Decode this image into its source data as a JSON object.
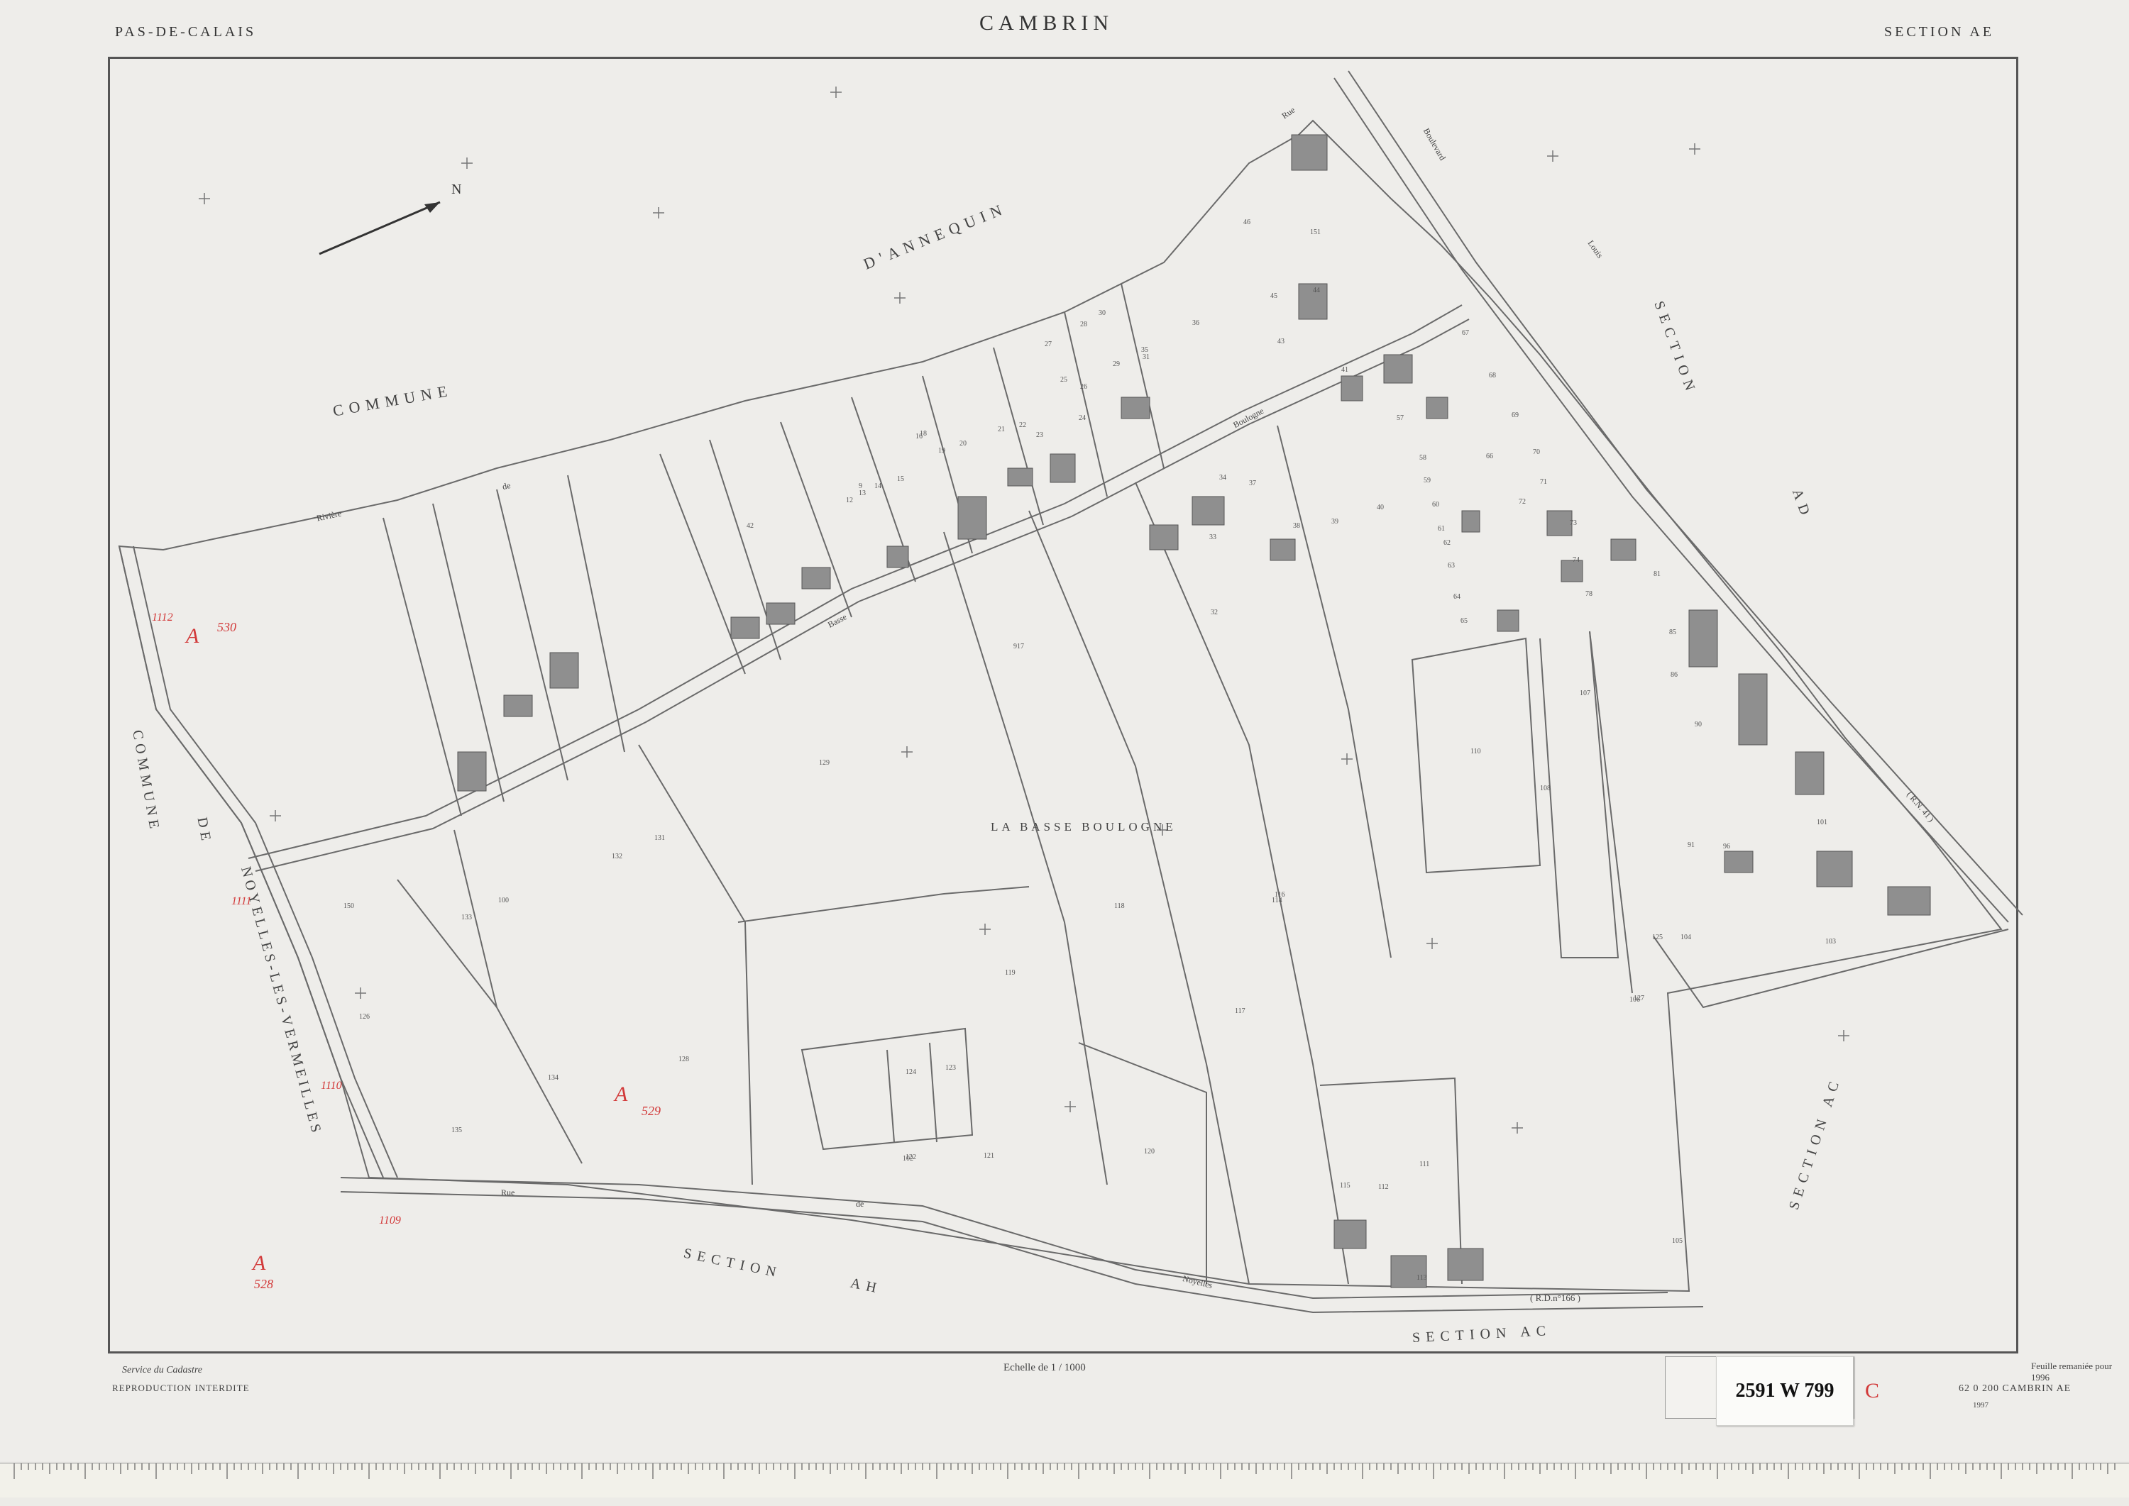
{
  "header": {
    "department": "PAS-DE-CALAIS",
    "commune": "CAMBRIN",
    "section": "SECTION  AE"
  },
  "map_labels": {
    "commune_annequin_1": "COMMUNE",
    "commune_annequin_2": "D'ANNEQUIN",
    "commune_noyelles_1": "COMMUNE",
    "commune_noyelles_2": "DE",
    "commune_noyelles_3": "NOYELLES-LES-VERMEILLES",
    "section_ad_1": "SECTION",
    "section_ad_2": "AD",
    "section_ac_right": "SECTION  AC",
    "section_ah_1": "SECTION",
    "section_ah_2": "AH",
    "section_ac_bottom": "SECTION  AC",
    "lieu_dit": "LA  BASSE  BOULOGNE",
    "north": "N",
    "rd_166": "( R.D.n°166 )",
    "rn_41": "( R.N. 41 )"
  },
  "street_names": [
    "Rivière",
    "de",
    "Rue",
    "de",
    "Noyelles",
    "Basse",
    "Boulogne",
    "Louis",
    "Rue",
    "Boulevard"
  ],
  "parcel_numbers": [
    "42",
    "9",
    "12",
    "13",
    "14",
    "15",
    "16",
    "18",
    "19",
    "20",
    "21",
    "22",
    "23",
    "24",
    "25",
    "26",
    "27",
    "28",
    "29",
    "30",
    "31",
    "32",
    "33",
    "34",
    "35",
    "36",
    "37",
    "38",
    "39",
    "40",
    "41",
    "43",
    "44",
    "45",
    "46",
    "57",
    "58",
    "59",
    "60",
    "61",
    "62",
    "63",
    "64",
    "65",
    "66",
    "67",
    "68",
    "69",
    "70",
    "71",
    "72",
    "73",
    "74",
    "78",
    "81",
    "85",
    "86",
    "90",
    "91",
    "96",
    "100",
    "101",
    "102",
    "103",
    "104",
    "105",
    "106",
    "107",
    "108",
    "110",
    "111",
    "112",
    "113",
    "114",
    "115",
    "116",
    "117",
    "118",
    "119",
    "120",
    "121",
    "122",
    "123",
    "124",
    "125",
    "126",
    "127",
    "128",
    "129",
    "131",
    "132",
    "133",
    "134",
    "135",
    "150",
    "151",
    "917"
  ],
  "annotations": {
    "a530_letter": "A",
    "a530_num": "530",
    "a529_letter": "A",
    "a529_num": "529",
    "a528_letter": "A",
    "a528_num": "528",
    "n1112": "1112",
    "n1111": "1111",
    "n1110": "1110",
    "n1109": "1109"
  },
  "footer": {
    "service": "Service du Cadastre",
    "repro": "REPRODUCTION INTERDITE",
    "scale": "Echelle de 1 / 1000",
    "feuille": "Feuille remaniée pour 1996",
    "commune_code": "62 0 200  CAMBRIN  AE",
    "date": "1997",
    "archive_ref": "2591 W 799",
    "red_mark": "C"
  },
  "colors": {
    "paper": "#eeedea",
    "line": "#666666",
    "building": "#8f8f8f",
    "annotation_red": "#d23a3a"
  }
}
